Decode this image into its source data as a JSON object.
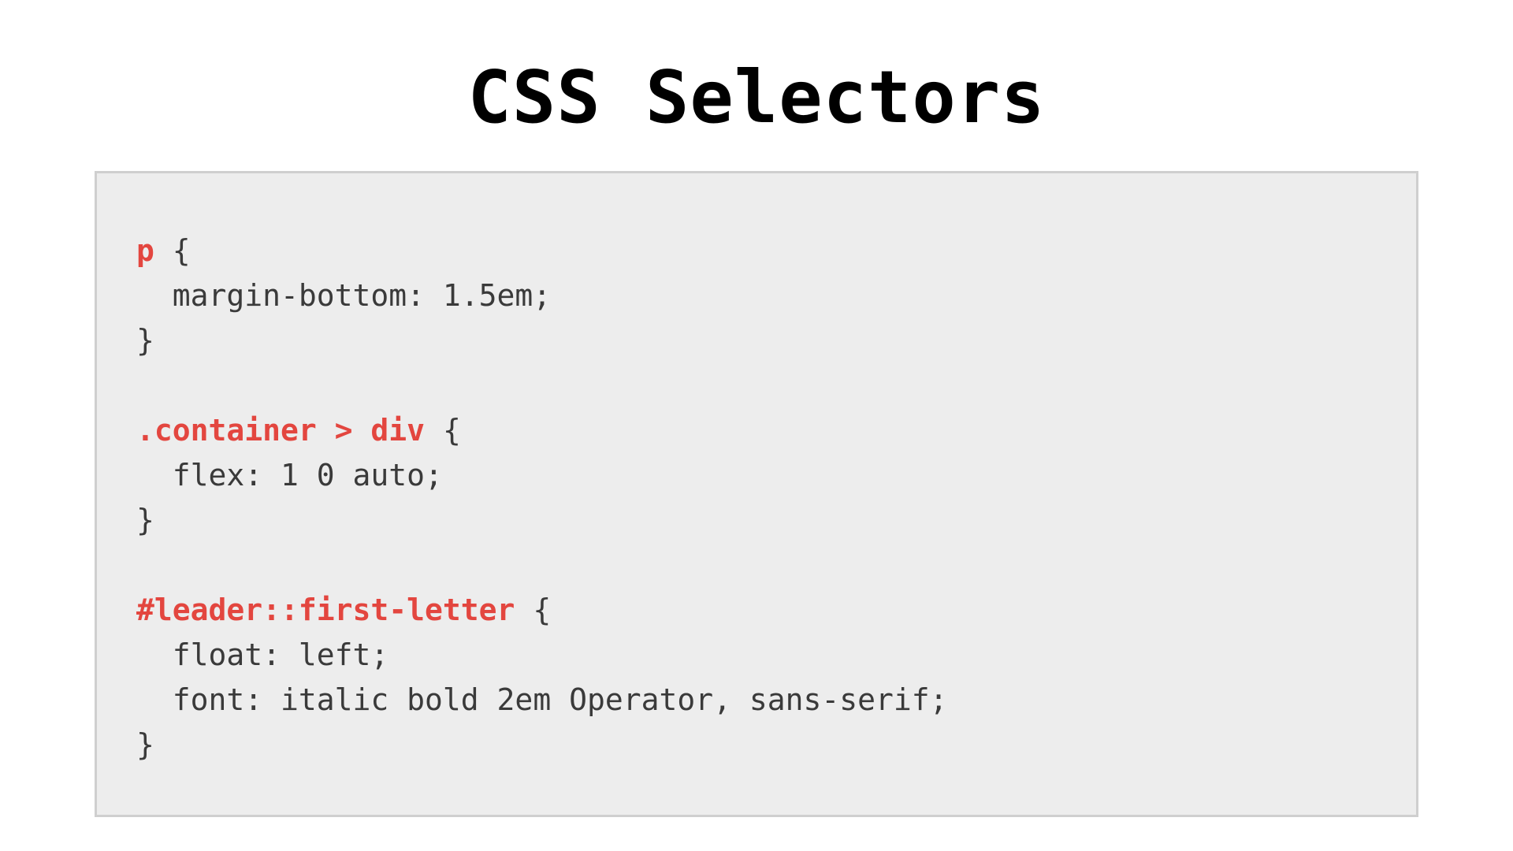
{
  "title": "CSS Selectors",
  "code": {
    "rules": [
      {
        "selector": "p",
        "declarations": [
          "margin-bottom: 1.5em;"
        ]
      },
      {
        "selector": ".container > div",
        "declarations": [
          "flex: 1 0 auto;"
        ]
      },
      {
        "selector": "#leader::first-letter",
        "declarations": [
          "float: left;",
          "font: italic bold 2em Operator, sans-serif;"
        ]
      }
    ]
  },
  "colors": {
    "selector": "#e3463f",
    "codeText": "#3a3a3a",
    "boxBg": "#ededed",
    "boxBorder": "#cfcfcf"
  }
}
